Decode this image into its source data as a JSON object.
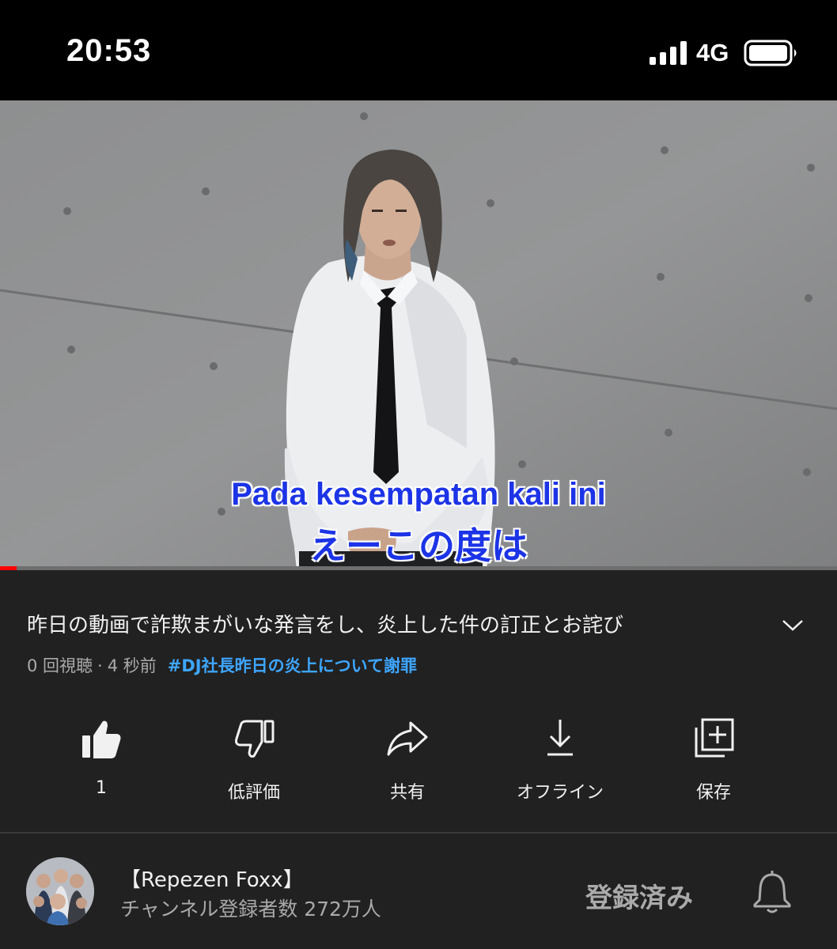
{
  "status_bar": {
    "time": "20:53",
    "network": "4G",
    "icons": [
      "signal-icon",
      "battery-icon"
    ]
  },
  "video": {
    "subtitle_line1": "Pada kesempatan kali ini",
    "subtitle_line2": "えーこの度は",
    "progress_fraction": 0.02,
    "subtitle_color": "#1c34e6",
    "progress_color": "#ff0000"
  },
  "info": {
    "title": "昨日の動画で詐欺まがいな発言をし、炎上した件の訂正とお詫び",
    "views": "0 回視聴",
    "separator": "·",
    "age": "4 秒前",
    "hashtag": "#DJ社長昨日の炎上について謝罪",
    "hashtag_color": "#3ea6ff"
  },
  "actions": [
    {
      "icon": "thumbs-up-icon",
      "label": "1"
    },
    {
      "icon": "thumbs-down-icon",
      "label": "低評価"
    },
    {
      "icon": "share-icon",
      "label": "共有"
    },
    {
      "icon": "download-icon",
      "label": "オフライン"
    },
    {
      "icon": "save-playlist-icon",
      "label": "保存"
    }
  ],
  "channel": {
    "name": "【Repezen Foxx】",
    "subscribers": "チャンネル登録者数 272万人",
    "subscribe_label": "登録済み",
    "icons": [
      "avatar",
      "bell-icon"
    ]
  }
}
